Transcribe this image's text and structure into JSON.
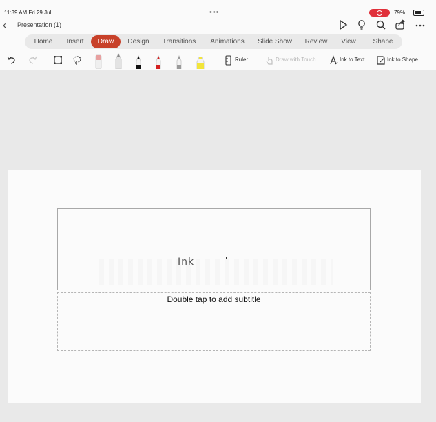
{
  "status": {
    "time": "11:39 AM  Fri 29 Jul",
    "battery": "79%",
    "more": "•••"
  },
  "titlebar": {
    "back_icon": "chevron-left-icon",
    "document_title": "Presentation (1)",
    "icons": [
      "play-icon",
      "lightbulb-icon",
      "search-icon",
      "share-icon",
      "more-icon"
    ]
  },
  "ribbon": {
    "tabs": [
      {
        "label": "Home"
      },
      {
        "label": "Insert"
      },
      {
        "label": "Draw"
      },
      {
        "label": "Design"
      },
      {
        "label": "Transitions"
      },
      {
        "label": "Animations"
      },
      {
        "label": "Slide Show"
      },
      {
        "label": "Review"
      },
      {
        "label": "View"
      },
      {
        "label": "Shape"
      }
    ],
    "active_tab": "Draw"
  },
  "draw_toolbar": {
    "undo_icon": "undo-icon",
    "redo_icon": "redo-icon",
    "select_icon": "rectangle-select-icon",
    "lasso_icon": "lasso-icon",
    "pens": [
      {
        "name": "eraser-icon",
        "color": "#e8a0a0"
      },
      {
        "name": "pencil-icon",
        "color": "#888888"
      },
      {
        "name": "pen-black-icon",
        "color": "#111111"
      },
      {
        "name": "pen-red-icon",
        "color": "#d42020"
      },
      {
        "name": "pen-gray-icon",
        "color": "#9a9a9a"
      },
      {
        "name": "highlighter-yellow-icon",
        "color": "#f2e53a"
      }
    ],
    "ruler_label": "Ruler",
    "draw_with_touch_label": "Draw with Touch",
    "ink_to_text_label": "Ink to Text",
    "ink_to_shape_label": "Ink to Shape"
  },
  "slide": {
    "ink_text": "Ink",
    "subtitle_placeholder": "Double tap to add subtitle"
  },
  "colors": {
    "accent": "#c8412a",
    "record": "#e0303a"
  }
}
